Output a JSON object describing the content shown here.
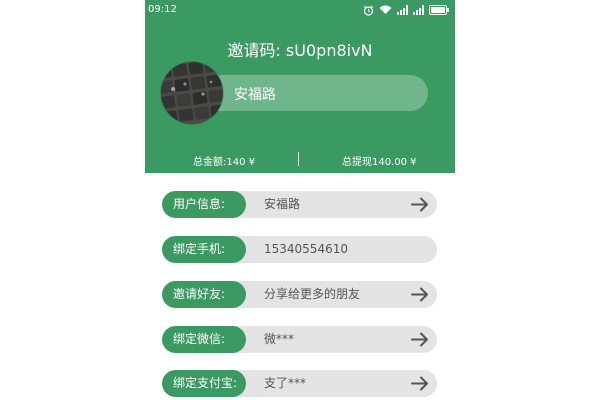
{
  "status_bar": {
    "time": "09:12",
    "icons": [
      "alarm-icon",
      "wifi-icon",
      "signal-icon",
      "signal-icon",
      "battery-icon"
    ]
  },
  "header": {
    "invite_title": "邀请码: sU0pn8ivN",
    "user_name": "安福路",
    "avatar_icon": "keyboard-photo-avatar",
    "total_amount": "总金额:140 ¥",
    "total_withdraw": "总提现140.00 ¥"
  },
  "rows": [
    {
      "label": "用户信息:",
      "value": "安福路",
      "has_arrow": true
    },
    {
      "label": "绑定手机:",
      "value": "15340554610",
      "has_arrow": false
    },
    {
      "label": "邀请好友:",
      "value": "分享给更多的朋友",
      "has_arrow": true
    },
    {
      "label": "绑定微信:",
      "value": "微***",
      "has_arrow": true
    },
    {
      "label": "绑定支付宝:",
      "value": "支了***",
      "has_arrow": true
    }
  ],
  "colors": {
    "accent": "#3a9a62",
    "pill_bg": "#e4e4e4",
    "arrow": "#555555"
  }
}
